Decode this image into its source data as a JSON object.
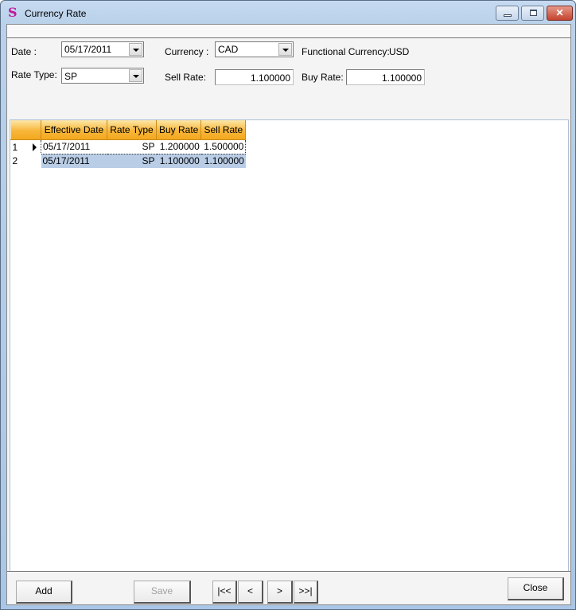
{
  "window": {
    "title": "Currency Rate",
    "icon": "app-s-logo-icon",
    "controls": [
      "minimize-icon",
      "maximize-icon",
      "close-icon"
    ]
  },
  "form": {
    "date_label": "Date :",
    "date_value": "05/17/2011",
    "currency_label": "Currency :",
    "currency_value": "CAD",
    "functional_currency_label": "Functional Currency:",
    "functional_currency_value": "USD",
    "rate_type_label": "Rate Type:",
    "rate_type_value": "SP",
    "sell_rate_label": "Sell Rate:",
    "sell_rate_value": "1.100000",
    "buy_rate_label": "Buy Rate:",
    "buy_rate_value": "1.100000"
  },
  "grid": {
    "columns": [
      "Effective Date",
      "Rate Type",
      "Buy Rate",
      "Sell Rate"
    ],
    "rows": [
      {
        "num": "1",
        "effective_date": "05/17/2011",
        "rate_type": "SP",
        "buy_rate": "1.200000",
        "sell_rate": "1.500000",
        "current": true
      },
      {
        "num": "2",
        "effective_date": "05/17/2011",
        "rate_type": "SP",
        "buy_rate": "1.100000",
        "sell_rate": "1.100000",
        "selected": true
      }
    ]
  },
  "buttons": {
    "add": "Add",
    "save": "Save",
    "first": "|<<",
    "prev": "<",
    "next": ">",
    "last": ">>|",
    "close": "Close"
  }
}
